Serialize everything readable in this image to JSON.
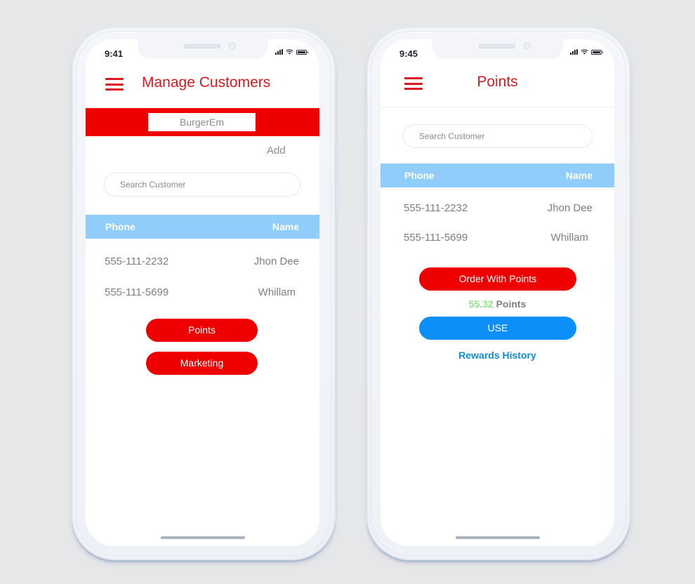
{
  "screens": [
    {
      "status_time": "9:41",
      "title": "Manage Customers",
      "brand_selector": "BurgerEm",
      "add_label": "Add",
      "search_placeholder": "Search Customer",
      "table": {
        "columns": [
          "Phone",
          "Name"
        ],
        "rows": [
          {
            "phone": "555-111-2232",
            "name": "Jhon Dee"
          },
          {
            "phone": "555-111-5699",
            "name": "Whillam"
          }
        ]
      },
      "buttons": {
        "points": "Points",
        "marketing": "Marketing"
      }
    },
    {
      "status_time": "9:45",
      "title": "Points",
      "search_placeholder": "Search Customer",
      "table": {
        "columns": [
          "Phone",
          "Name"
        ],
        "rows": [
          {
            "phone": "555-111-2232",
            "name": "Jhon Dee"
          },
          {
            "phone": "555-111-5699",
            "name": "Whillam"
          }
        ]
      },
      "buttons": {
        "order_with_points": "Order With Points",
        "use": "USE"
      },
      "points_balance": {
        "value": "55.32",
        "unit": "Points"
      },
      "rewards_history_label": "Rewards History"
    }
  ],
  "colors": {
    "brand_red": "#ee0000",
    "title_red": "#d71920",
    "table_header_blue": "#90cdfb",
    "action_blue": "#0d8ffa",
    "link_blue": "#0b8ce0",
    "points_green": "#8fe08a"
  },
  "icons": {
    "menu": "hamburger-icon",
    "signal": "cellular-signal-icon",
    "wifi": "wifi-icon",
    "battery": "battery-icon"
  }
}
